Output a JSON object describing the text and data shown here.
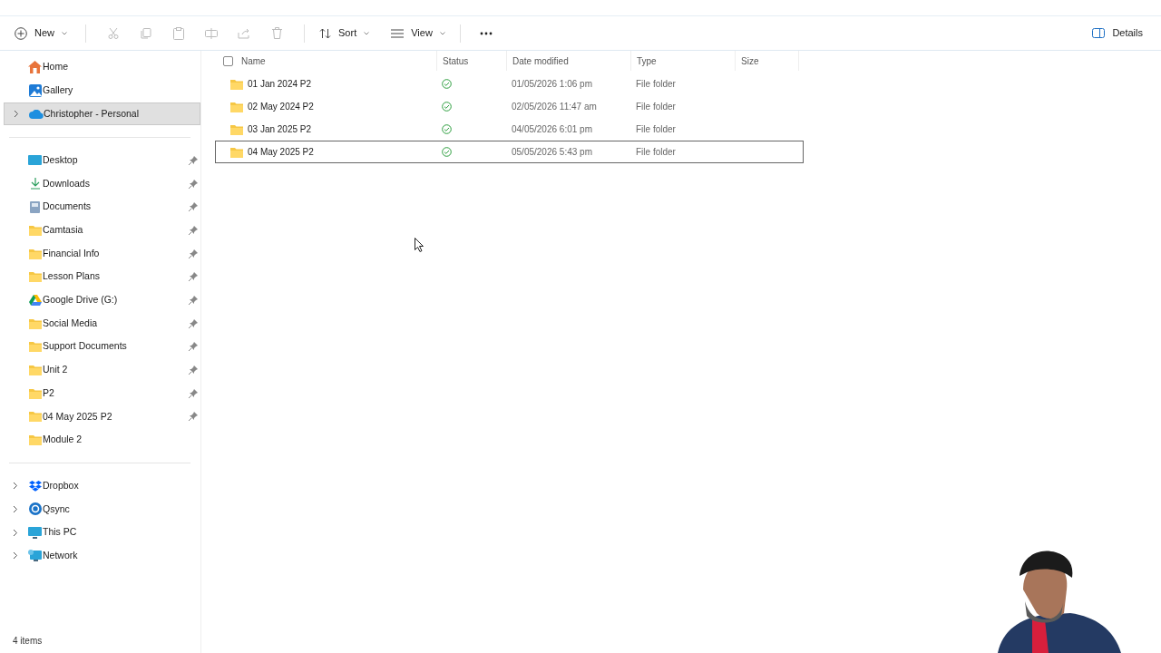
{
  "toolbar": {
    "new": "New",
    "sort": "Sort",
    "view": "View",
    "details": "Details"
  },
  "sidebar": {
    "top": [
      {
        "label": "Home",
        "selected": false
      },
      {
        "label": "Gallery",
        "selected": false
      },
      {
        "label": "Christopher - Personal",
        "selected": true
      }
    ],
    "quick_access": [
      {
        "label": "Desktop",
        "pinned": true
      },
      {
        "label": "Downloads",
        "pinned": true
      },
      {
        "label": "Documents",
        "pinned": true
      },
      {
        "label": "Camtasia",
        "pinned": true
      },
      {
        "label": "Financial Info",
        "pinned": true
      },
      {
        "label": "Lesson Plans",
        "pinned": true
      },
      {
        "label": "Google Drive (G:)",
        "pinned": true
      },
      {
        "label": "Social Media",
        "pinned": true
      },
      {
        "label": "Support Documents",
        "pinned": true
      },
      {
        "label": "Unit 2",
        "pinned": true
      },
      {
        "label": "P2",
        "pinned": true
      },
      {
        "label": "04 May 2025 P2",
        "pinned": true
      },
      {
        "label": "Module 2",
        "pinned": false
      }
    ],
    "locations": [
      {
        "label": "Dropbox"
      },
      {
        "label": "Qsync"
      },
      {
        "label": "This PC"
      },
      {
        "label": "Network"
      }
    ]
  },
  "table": {
    "select_all_checked": false,
    "columns": [
      "Name",
      "Status",
      "Date modified",
      "Type",
      "Size"
    ],
    "rows": [
      {
        "name": "01 Jan 2024 P2",
        "date": "01/05/2026 1:06 pm",
        "type": "File folder",
        "selected": false
      },
      {
        "name": "02 May 2024 P2",
        "date": "02/05/2026 11:47 am",
        "type": "File folder",
        "selected": false
      },
      {
        "name": "03 Jan 2025 P2",
        "date": "04/05/2026 6:01 pm",
        "type": "File folder",
        "selected": false
      },
      {
        "name": "04 May 2025 P2",
        "date": "05/05/2026 5:43 pm",
        "type": "File folder",
        "selected": true
      }
    ]
  },
  "status_bar": "4 items"
}
